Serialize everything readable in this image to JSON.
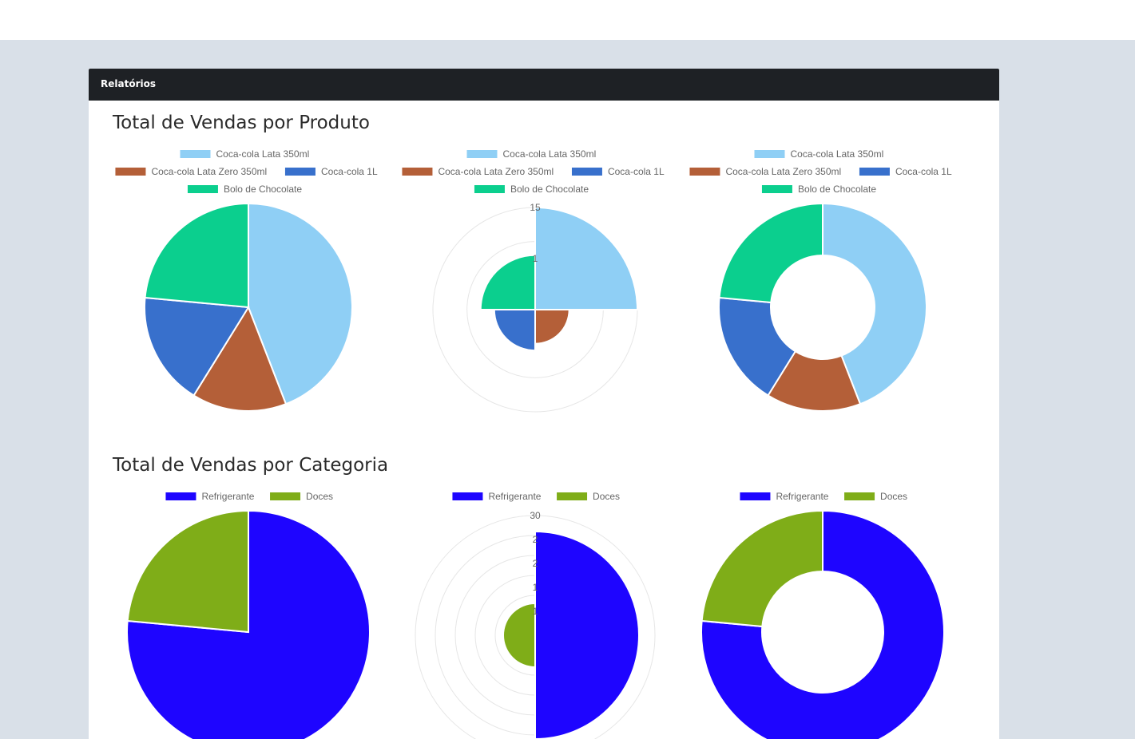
{
  "card": {
    "title": "Relatórios"
  },
  "sections": [
    {
      "title": "Total de Vendas por Produto"
    },
    {
      "title": "Total de Vendas por Categoria"
    }
  ],
  "chart_data": [
    {
      "type": "pie",
      "categories": [
        "Coca-cola Lata 350ml",
        "Coca-cola Lata Zero 350ml",
        "Coca-cola 1L",
        "Bolo de Chocolate"
      ],
      "values": [
        15,
        5,
        6,
        8
      ],
      "colors": [
        "#8fcff5",
        "#b45f38",
        "#3870cc",
        "#0bcf8e"
      ],
      "legend": "top"
    },
    {
      "type": "polarArea",
      "categories": [
        "Coca-cola Lata 350ml",
        "Coca-cola Lata Zero 350ml",
        "Coca-cola 1L",
        "Bolo de Chocolate"
      ],
      "values": [
        15,
        5,
        6,
        8
      ],
      "colors": [
        "#8fcff5",
        "#b45f38",
        "#3870cc",
        "#0bcf8e"
      ],
      "rmax": 15,
      "ticks": [
        "15",
        "1"
      ],
      "legend": "top"
    },
    {
      "type": "doughnut",
      "categories": [
        "Coca-cola Lata 350ml",
        "Coca-cola Lata Zero 350ml",
        "Coca-cola 1L",
        "Bolo de Chocolate"
      ],
      "values": [
        15,
        5,
        6,
        8
      ],
      "colors": [
        "#8fcff5",
        "#b45f38",
        "#3870cc",
        "#0bcf8e"
      ],
      "legend": "top"
    },
    {
      "type": "pie",
      "categories": [
        "Refrigerante",
        "Doces"
      ],
      "values": [
        26,
        8
      ],
      "colors": [
        "#1e05ff",
        "#7fad18"
      ],
      "legend": "top"
    },
    {
      "type": "polarArea",
      "categories": [
        "Refrigerante",
        "Doces"
      ],
      "values": [
        26,
        8
      ],
      "colors": [
        "#1e05ff",
        "#7fad18"
      ],
      "rmax": 30,
      "ticks": [
        "30",
        "2",
        "2",
        "1",
        "1"
      ],
      "legend": "top"
    },
    {
      "type": "doughnut",
      "categories": [
        "Refrigerante",
        "Doces"
      ],
      "values": [
        26,
        8
      ],
      "colors": [
        "#1e05ff",
        "#7fad18"
      ],
      "legend": "top"
    }
  ]
}
